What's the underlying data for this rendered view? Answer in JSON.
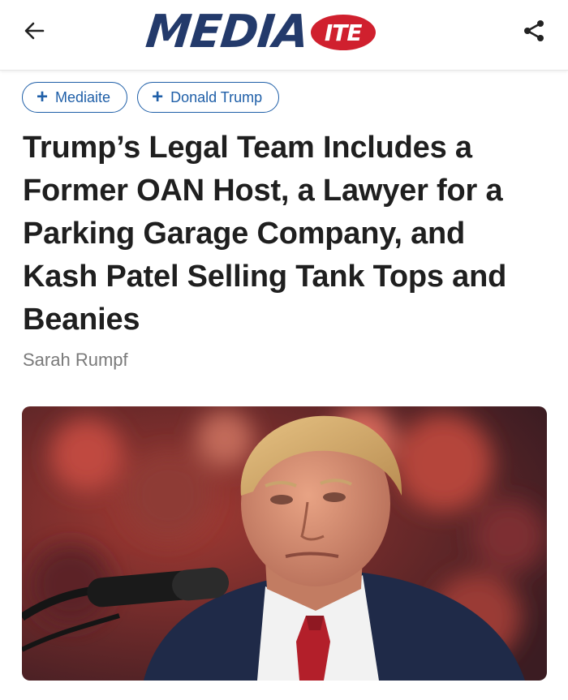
{
  "header": {
    "logo_main": "MEDIA",
    "logo_badge": "ITE"
  },
  "tags": [
    {
      "label": "Mediaite"
    },
    {
      "label": "Donald Trump"
    }
  ],
  "article": {
    "headline": "Trump’s Legal Team Includes a Former OAN Host, a Lawyer for a Parking Garage Company, and Kash Patel Selling Tank Tops and Beanies",
    "author": "Sarah Rumpf"
  },
  "colors": {
    "logo_navy": "#233a6b",
    "logo_red": "#d0202e",
    "tag_blue": "#1f5fa8"
  }
}
